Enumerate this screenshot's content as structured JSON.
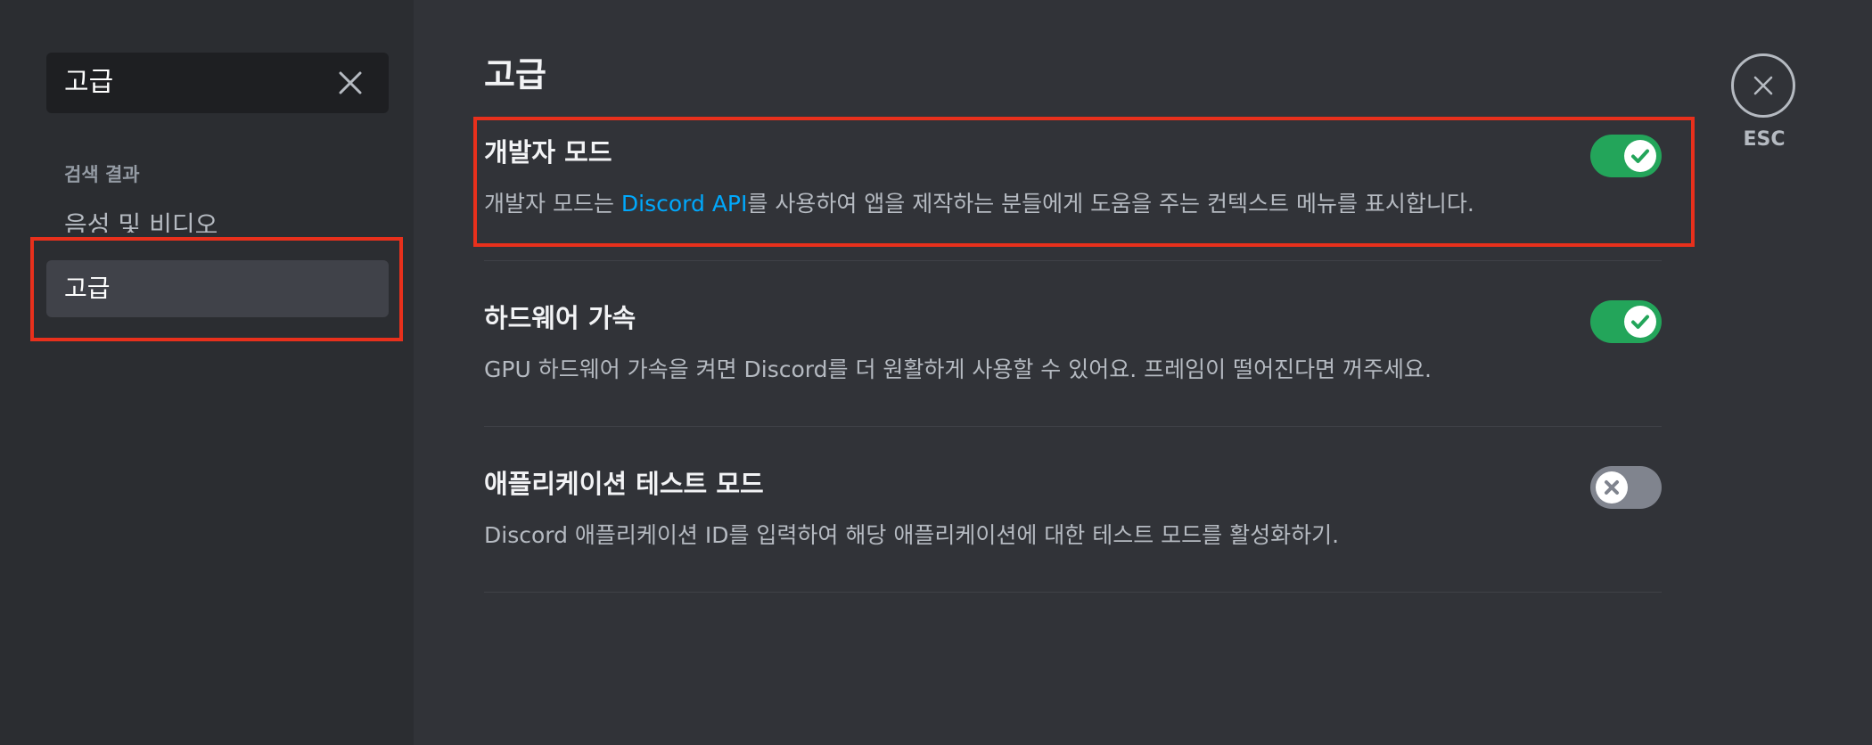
{
  "sidebar": {
    "search": {
      "value": "고급",
      "clear_icon": "close-icon"
    },
    "results_heading": "검색 결과",
    "items": [
      {
        "label": "음성 및 비디오"
      },
      {
        "label": "고급",
        "selected": true
      }
    ]
  },
  "main": {
    "title": "고급",
    "settings": [
      {
        "title": "개발자 모드",
        "desc_before": "개발자 모드는 ",
        "desc_link": "Discord API",
        "desc_after": "를 사용하여 앱을 제작하는 분들에게 도움을 주는 컨텍스트 메뉴를 표시합니다.",
        "enabled": true
      },
      {
        "title": "하드웨어 가속",
        "desc": "GPU 하드웨어 가속을 켜면 Discord를 더 원활하게 사용할 수 있어요. 프레임이 떨어진다면 꺼주세요.",
        "enabled": true
      },
      {
        "title": "애플리케이션 테스트 모드",
        "desc": "Discord 애플리케이션 ID를 입력하여 해당 애플리케이션에 대한 테스트 모드를 활성화하기.",
        "enabled": false
      }
    ]
  },
  "close": {
    "icon": "close-icon",
    "label": "ESC"
  },
  "colors": {
    "background": "#313338",
    "sidebar": "#2b2d31",
    "toggle_on": "#23a55a",
    "toggle_off": "#80848e",
    "link": "#00a8fc",
    "highlight": "#e8301c"
  }
}
